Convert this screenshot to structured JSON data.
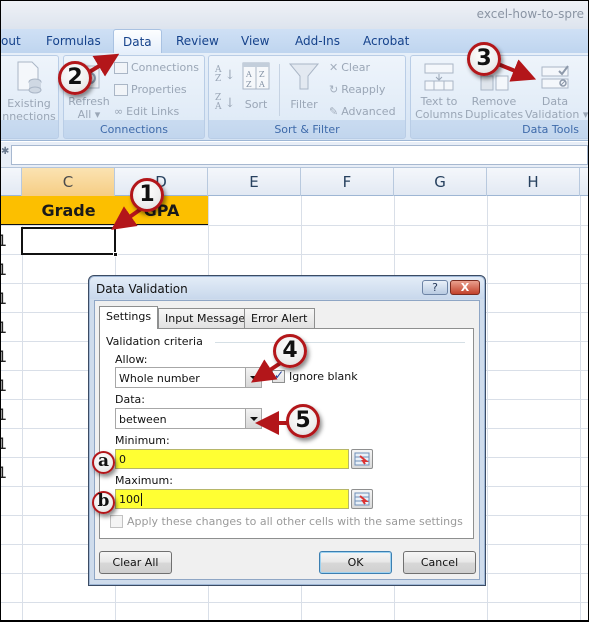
{
  "window": {
    "title": "excel-how-to-spre"
  },
  "ribbon_tabs": [
    {
      "label": "out"
    },
    {
      "label": "Formulas"
    },
    {
      "label": "Data",
      "active": true
    },
    {
      "label": "Review"
    },
    {
      "label": "View"
    },
    {
      "label": "Add-Ins"
    },
    {
      "label": "Acrobat"
    }
  ],
  "ribbon": {
    "get_external": {
      "existing_connections": [
        "Existing",
        "nnections"
      ]
    },
    "connections": {
      "label": "Connections",
      "refresh_all": [
        "Refresh",
        "All ▾"
      ],
      "connections_btn": "Connections",
      "properties_btn": "Properties",
      "edit_links_btn": "Edit Links"
    },
    "sort_filter": {
      "label": "Sort & Filter",
      "sort_btn": "Sort",
      "filter_btn": "Filter",
      "clear_btn": "Clear",
      "reapply_btn": "Reapply",
      "advanced_btn": "Advanced"
    },
    "data_tools": {
      "label": "Data Tools",
      "text_to_columns": [
        "Text to",
        "Columns"
      ],
      "remove_duplicates": [
        "Remove",
        "Duplicates"
      ],
      "data_validation": [
        "Data",
        "Validation ▾"
      ]
    }
  },
  "sheet": {
    "columns": [
      "C",
      "D",
      "E",
      "F",
      "G",
      "H"
    ],
    "selected_column": "C",
    "header_cells": {
      "grade": "Grade",
      "gpa": "GPA"
    },
    "row_fragments": [
      "1",
      "1",
      "1",
      "1",
      "1",
      "1",
      "1",
      "1",
      "1"
    ],
    "header_color": "#FCBF00"
  },
  "dialog": {
    "title": "Data Validation",
    "help_label": "?",
    "close_label": "X",
    "tabs": [
      "Settings",
      "Input Message",
      "Error Alert"
    ],
    "active_tab": "Settings",
    "section_label": "Validation criteria",
    "allow": {
      "label": "Allow:",
      "value": "Whole number"
    },
    "ignore_blank": {
      "label": "Ignore blank",
      "checked": true
    },
    "data": {
      "label": "Data:",
      "value": "between"
    },
    "minimum": {
      "label": "Minimum:",
      "value": "0"
    },
    "maximum": {
      "label": "Maximum:",
      "value": "100"
    },
    "apply_all": {
      "label": "Apply these changes to all other cells with the same settings",
      "checked": false,
      "enabled": false
    },
    "buttons": {
      "clear_all": "Clear All",
      "ok": "OK",
      "cancel": "Cancel"
    },
    "highlight_color": "#FFFF33"
  },
  "callouts": {
    "step1": "1",
    "step2": "2",
    "step3": "3",
    "step4": "4",
    "step5": "5",
    "step_a": "a",
    "step_b": "b",
    "color": "#B3161A"
  }
}
